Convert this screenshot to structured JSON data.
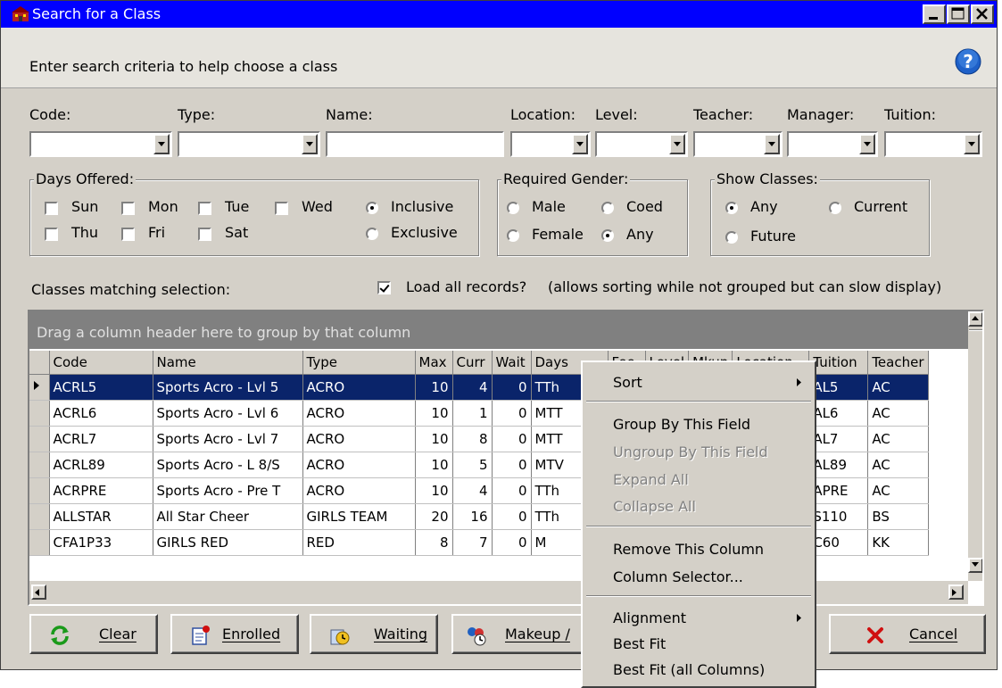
{
  "window": {
    "title": "Search for a Class",
    "header_text": "Enter search criteria to help choose a class"
  },
  "filters": {
    "code_label": "Code:",
    "type_label": "Type:",
    "name_label": "Name:",
    "location_label": "Location:",
    "level_label": "Level:",
    "teacher_label": "Teacher:",
    "manager_label": "Manager:",
    "tuition_label": "Tuition:"
  },
  "days": {
    "title": "Days Offered:",
    "sun": "Sun",
    "mon": "Mon",
    "tue": "Tue",
    "wed": "Wed",
    "thu": "Thu",
    "fri": "Fri",
    "sat": "Sat",
    "inclusive": "Inclusive",
    "exclusive": "Exclusive",
    "selected_mode": "Inclusive"
  },
  "gender": {
    "title": "Required Gender:",
    "male": "Male",
    "coed": "Coed",
    "female": "Female",
    "any": "Any",
    "selected": "Any"
  },
  "show": {
    "title": "Show Classes:",
    "any": "Any",
    "current": "Current",
    "future": "Future",
    "selected": "Any"
  },
  "results": {
    "label": "Classes matching selection:",
    "load_all_label": "Load all records?",
    "load_all_note": "(allows sorting while not grouped but can slow display)",
    "load_all_checked": true,
    "group_band": "Drag a column header here to group by that column"
  },
  "grid": {
    "columns": [
      "Code",
      "Name",
      "Type",
      "Max",
      "Curr",
      "Wait",
      "Days",
      "Fee",
      "Level",
      "Mkup",
      "Location",
      "Tuition",
      "Teacher"
    ],
    "visible_headers": {
      "code": "Code",
      "name": "Name",
      "type": "Type",
      "max": "Max",
      "curr": "Curr",
      "wait": "Wait",
      "days": "Days",
      "fee": "Fee",
      "level": "Level",
      "mkup": "Mkup",
      "location": "Location",
      "tuition": "Tuition",
      "teacher": "Teacher"
    },
    "rows": [
      {
        "code": "ACRL5",
        "name": "Sports Acro - Lvl 5",
        "type": "ACRO",
        "max": "10",
        "curr": "4",
        "wait": "0",
        "days": "TTh",
        "tuition": "AL5",
        "teacher": "AC"
      },
      {
        "code": "ACRL6",
        "name": "Sports Acro - Lvl 6",
        "type": "ACRO",
        "max": "10",
        "curr": "1",
        "wait": "0",
        "days": "MTT",
        "tuition": "AL6",
        "teacher": "AC"
      },
      {
        "code": "ACRL7",
        "name": "Sports Acro - Lvl 7",
        "type": "ACRO",
        "max": "10",
        "curr": "8",
        "wait": "0",
        "days": "MTT",
        "tuition": "AL7",
        "teacher": "AC"
      },
      {
        "code": "ACRL89",
        "name": "Sports Acro - L 8/S",
        "type": "ACRO",
        "max": "10",
        "curr": "5",
        "wait": "0",
        "days": "MTV",
        "tuition": "AL89",
        "teacher": "AC"
      },
      {
        "code": "ACRPRE",
        "name": "Sports Acro - Pre T",
        "type": "ACRO",
        "max": "10",
        "curr": "4",
        "wait": "0",
        "days": "TTh",
        "tuition": "APRE",
        "teacher": "AC"
      },
      {
        "code": "ALLSTAR",
        "name": "All Star Cheer",
        "type": "GIRLS TEAM",
        "max": "20",
        "curr": "16",
        "wait": "0",
        "days": "TTh",
        "tuition": "S110",
        "teacher": "BS"
      },
      {
        "code": "CFA1P33",
        "name": "GIRLS RED",
        "type": "RED",
        "max": "8",
        "curr": "7",
        "wait": "0",
        "days": "M",
        "tuition": "C60",
        "teacher": "KK"
      }
    ],
    "selected_row": 0
  },
  "buttons": {
    "clear": "Clear",
    "enrolled": "Enrolled",
    "waiting": "Waiting",
    "makeup": "Makeup /",
    "cancel": "Cancel"
  },
  "context_menu": {
    "sort": "Sort",
    "group_by": "Group By This Field",
    "ungroup_by": "Ungroup By This Field",
    "expand_all": "Expand All",
    "collapse_all": "Collapse All",
    "remove_column": "Remove This Column",
    "column_selector": "Column Selector...",
    "alignment": "Alignment",
    "best_fit": "Best Fit",
    "best_fit_all": "Best Fit (all Columns)"
  },
  "colors": {
    "titlebar": "#0000ff",
    "selection": "#0a246a",
    "face": "#d4d0c8",
    "group_band": "#808080"
  },
  "icons": {
    "app": "app-building-icon",
    "help": "help-question-icon",
    "clear": "refresh-arrows-icon",
    "enrolled": "enrolled-list-icon",
    "waiting": "waiting-clock-icon",
    "makeup": "makeup-class-icon",
    "cancel": "cancel-x-icon"
  }
}
